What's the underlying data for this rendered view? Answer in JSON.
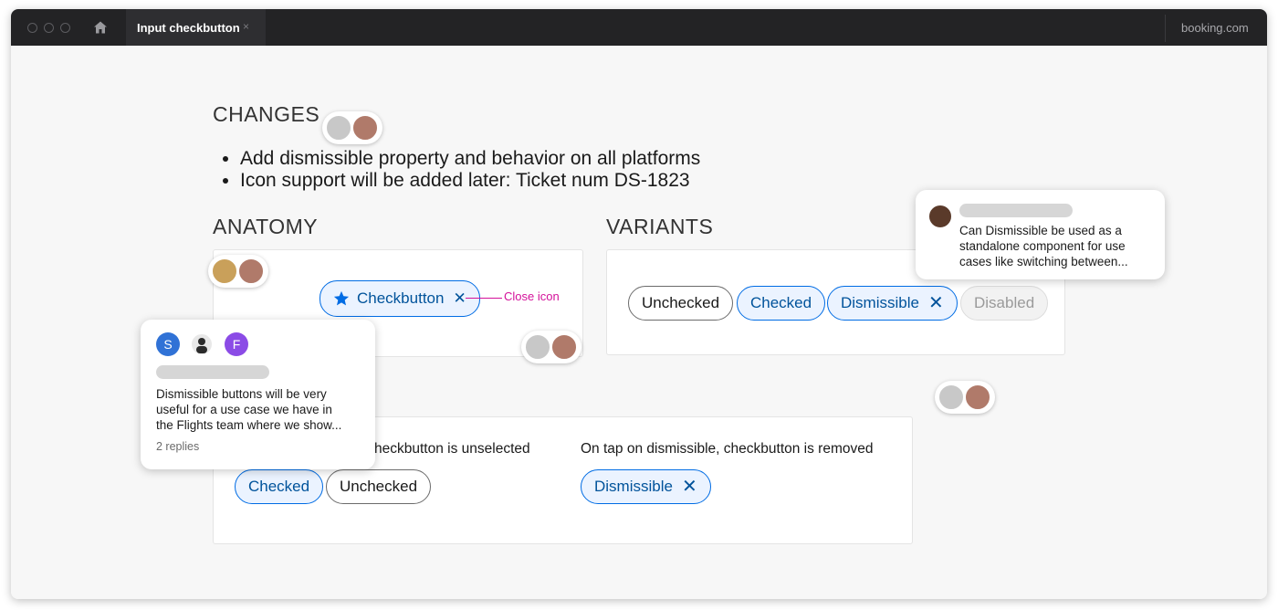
{
  "window": {
    "tab_title": "Input checkbutton",
    "tab_close": "×",
    "domain": "booking.com"
  },
  "colors": {
    "titlebar": "#232325",
    "accent_blue": "#006ce4",
    "checked_text": "#00539b",
    "checked_bg": "#ebf3ff",
    "annotation": "#d4119a"
  },
  "changes": {
    "heading": "CHANGES",
    "items": [
      "Add dismissible property and behavior on all platforms",
      "Icon support will be added later: Ticket num DS-1823"
    ]
  },
  "anatomy": {
    "heading": "ANATOMY",
    "pill_label": "Checkbutton",
    "pill_icon": "star-icon",
    "close_glyph": "✕",
    "annotation": "Close icon"
  },
  "variants": {
    "heading": "VARIANTS",
    "items": [
      {
        "label": "Unchecked",
        "state": "unchecked"
      },
      {
        "label": "Checked",
        "state": "checked"
      },
      {
        "label": "Dismissible",
        "state": "checked",
        "dismissible": true
      },
      {
        "label": "Disabled",
        "state": "disabled"
      }
    ]
  },
  "behavior": {
    "left_caption": "heckbutton is unselected",
    "left_pills": [
      "Checked",
      "Unchecked"
    ],
    "right_caption": "On tap on dismissible, checkbutton is removed",
    "right_pill": "Dismissible"
  },
  "comments": {
    "left": {
      "avatars": [
        "S",
        "F"
      ],
      "text_lines": [
        "Dismissible buttons will be very",
        "useful for a use case we have in",
        "the Flights team where we show..."
      ],
      "replies": "2 replies"
    },
    "right": {
      "text_lines": [
        "Can Dismissible be used as a",
        "standalone component for use",
        "cases like switching between..."
      ]
    }
  }
}
